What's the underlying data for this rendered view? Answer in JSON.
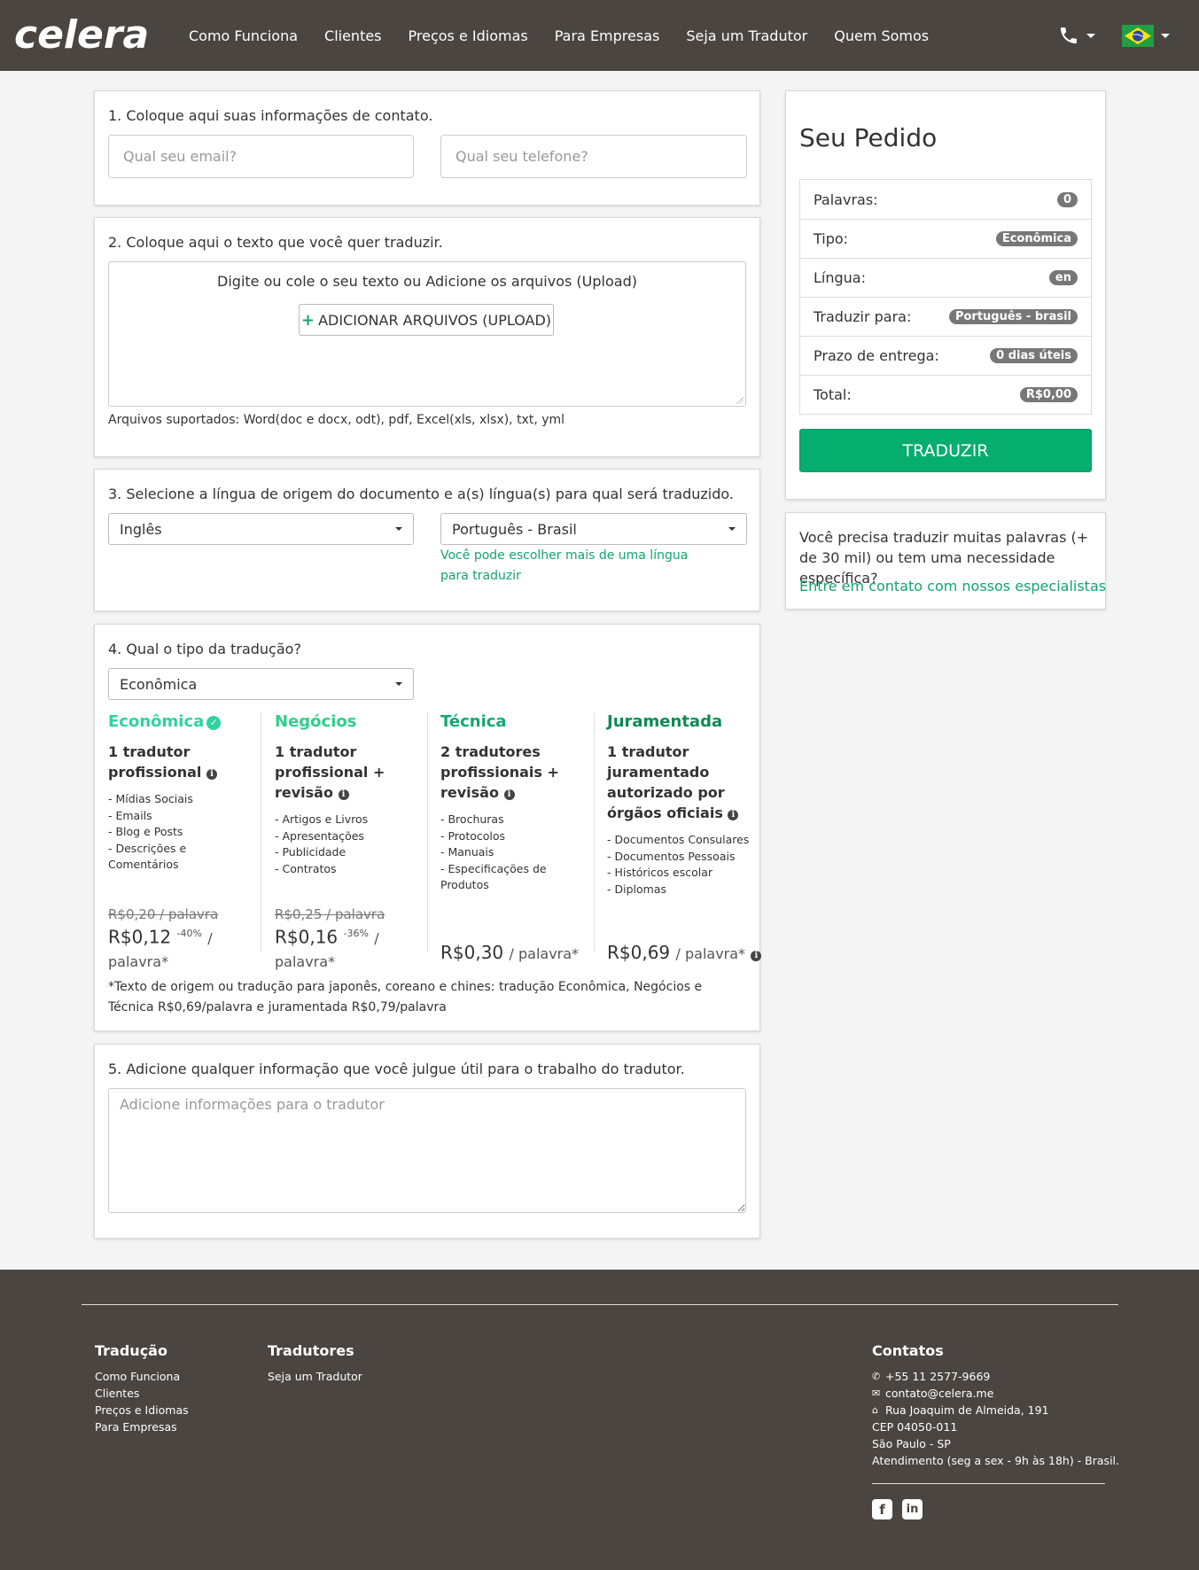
{
  "nav": {
    "logo_text": "celera",
    "links": [
      "Como Funciona",
      "Clientes",
      "Preços e Idiomas",
      "Para Empresas",
      "Seja um Tradutor",
      "Quem Somos"
    ]
  },
  "step1": {
    "title": "1. Coloque aqui suas informações de contato.",
    "email_placeholder": "Qual seu email?",
    "phone_placeholder": "Qual seu telefone?"
  },
  "step2": {
    "title": "2. Coloque aqui o texto que você quer traduzir.",
    "dropzone_text": "Digite ou cole o seu texto ou Adicione os arquivos (Upload)",
    "upload_label": "ADICIONAR ARQUIVOS (UPLOAD)",
    "supported": "Arquivos suportados: Word(doc e docx, odt), pdf, Excel(xls, xlsx), txt, yml"
  },
  "step3": {
    "title": "3. Selecione a língua de origem do documento e a(s) língua(s) para qual será traduzido.",
    "source_lang": "Inglês",
    "target_lang": "Português - Brasil",
    "hint": "Você pode escolher mais de uma língua para traduzir"
  },
  "step4": {
    "title": "4. Qual o tipo da tradução?",
    "selected": "Econômica",
    "types": [
      {
        "name": "Econômica",
        "color": "#2fd39e",
        "desc": "1 tradutor profissional",
        "items": [
          "Mídias Sociais",
          "Emails",
          "Blog e Posts",
          "Descrições e Comentários"
        ],
        "old_price": "R$0,20 / palavra",
        "price": "R$0,12",
        "discount": "-40%",
        "unit": "/ palavra*"
      },
      {
        "name": "Negócios",
        "color": "#2fcf8c",
        "desc": "1 tradutor profissional + revisão",
        "items": [
          "Artigos e Livros",
          "Apresentações",
          "Publicidade",
          "Contratos"
        ],
        "old_price": "R$0,25 / palavra",
        "price": "R$0,16",
        "discount": "-36%",
        "unit": "/ palavra*"
      },
      {
        "name": "Técnica",
        "color": "#14a874",
        "desc": "2 tradutores profissionais + revisão",
        "items": [
          "Brochuras",
          "Protocolos",
          "Manuais",
          "Especificações de Produtos"
        ],
        "price": "R$0,30",
        "unit": "/ palavra*"
      },
      {
        "name": "Juramentada",
        "color": "#0d8a55",
        "desc": "1 tradutor juramentado autorizado por órgãos oficiais",
        "items": [
          "Documentos Consulares",
          "Documentos Pessoais",
          "Históricos escolar",
          "Diplomas"
        ],
        "price": "R$0,69",
        "unit": "/ palavra*"
      }
    ],
    "note": "*Texto de origem ou tradução para japonês, coreano e chines: tradução Econômica, Negócios e Técnica R$0,69/palavra e juramentada R$0,79/palavra"
  },
  "step5": {
    "title": "5. Adicione qualquer informação que você julgue útil para o trabalho do tradutor.",
    "placeholder": "Adicione informações para o tradutor"
  },
  "order": {
    "title": "Seu Pedido",
    "rows": [
      {
        "label": "Palavras:",
        "value": "0"
      },
      {
        "label": "Tipo:",
        "value": "Econômica"
      },
      {
        "label": "Língua:",
        "value": "en"
      },
      {
        "label": "Traduzir para:",
        "value": "Português - brasil"
      },
      {
        "label": "Prazo de entrega:",
        "value": "0 dias úteis"
      },
      {
        "label": "Total:",
        "value": "R$0,00"
      }
    ],
    "button": "TRADUZIR"
  },
  "contact_box": {
    "text": "Você precisa traduzir muitas palavras (+ de 30 mil) ou tem uma necessidade específica?",
    "link": "Entre em contato com nossos especialistas"
  },
  "footer": {
    "col1": {
      "title": "Tradução",
      "items": [
        "Como Funciona",
        "Clientes",
        "Preços e Idiomas",
        "Para Empresas"
      ]
    },
    "col2": {
      "title": "Tradutores",
      "items": [
        "Seja um Tradutor"
      ]
    },
    "col3": {
      "title": "Contatos",
      "phone": "+55 11 2577-9669",
      "email": "contato@celera.me",
      "address": "Rua Joaquim de Almeida, 191",
      "cep": "CEP 04050-011",
      "city": "São Paulo - SP",
      "hours": "Atendimento (seg a sex - 9h às 18h) - Brasil."
    }
  },
  "colors": {
    "brand_green": "#05ad6f",
    "nav_bg": "#4a4541",
    "badge": "#777777"
  }
}
